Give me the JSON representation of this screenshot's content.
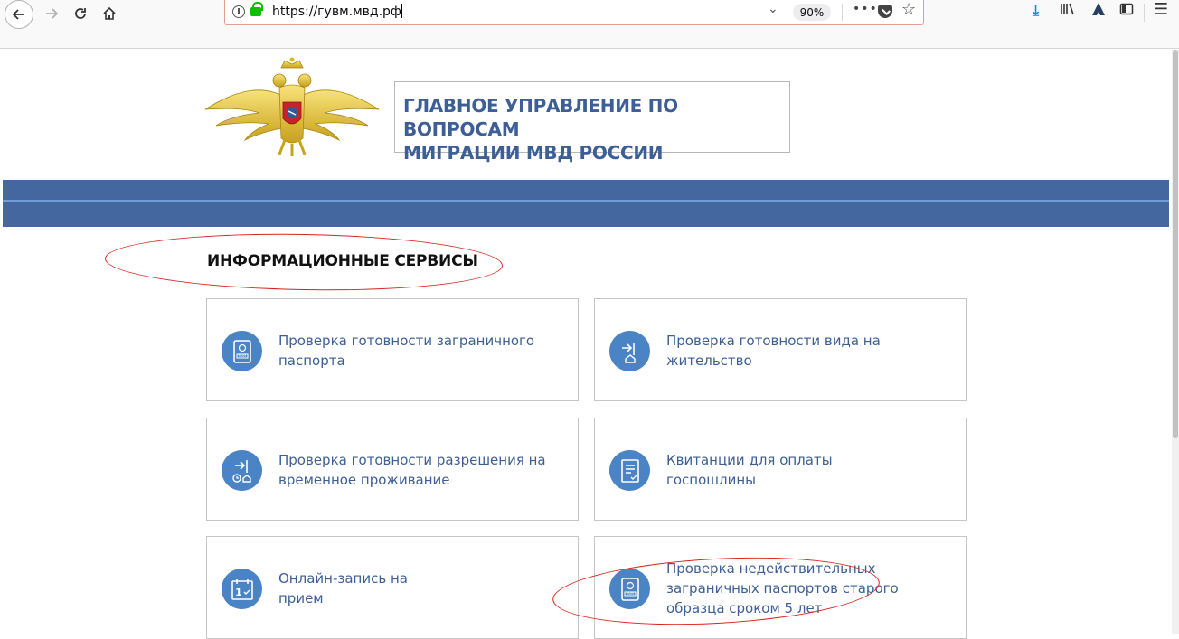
{
  "browser": {
    "url": "https://гувм.мвд.рф",
    "zoom": "90%",
    "more_label": "•••"
  },
  "header": {
    "title_line1": "ГЛАВНОЕ УПРАВЛЕНИЕ ПО ВОПРОСАМ",
    "title_line2": "МИГРАЦИИ МВД РОССИИ"
  },
  "section": {
    "title": "ИНФОРМАЦИОННЫЕ СЕРВИСЫ"
  },
  "cards": [
    {
      "line1": "Проверка готовности заграничного",
      "line2": "паспорта",
      "line3": "",
      "icon": "passport-icon"
    },
    {
      "line1": "Проверка готовности вида на",
      "line2": "жительство",
      "line3": "",
      "icon": "residence-icon"
    },
    {
      "line1": "Проверка готовности разрешения на",
      "line2": "временное проживание",
      "line3": "",
      "icon": "temporary-residence-icon"
    },
    {
      "line1": "Квитанции для оплаты",
      "line2": "госпошлины",
      "line3": "",
      "icon": "receipt-icon"
    },
    {
      "line1": "Онлайн-запись на",
      "line2": "прием",
      "line3": "",
      "icon": "calendar-icon"
    },
    {
      "line1": "Проверка недействительных",
      "line2": "заграничных паспортов старого",
      "line3": "образца сроком 5 лет",
      "icon": "passport-icon"
    }
  ],
  "colors": {
    "accent": "#3d5f95",
    "banner": "#44679f",
    "icon_bg": "#4a84c4",
    "annotation": "#d9221c"
  }
}
